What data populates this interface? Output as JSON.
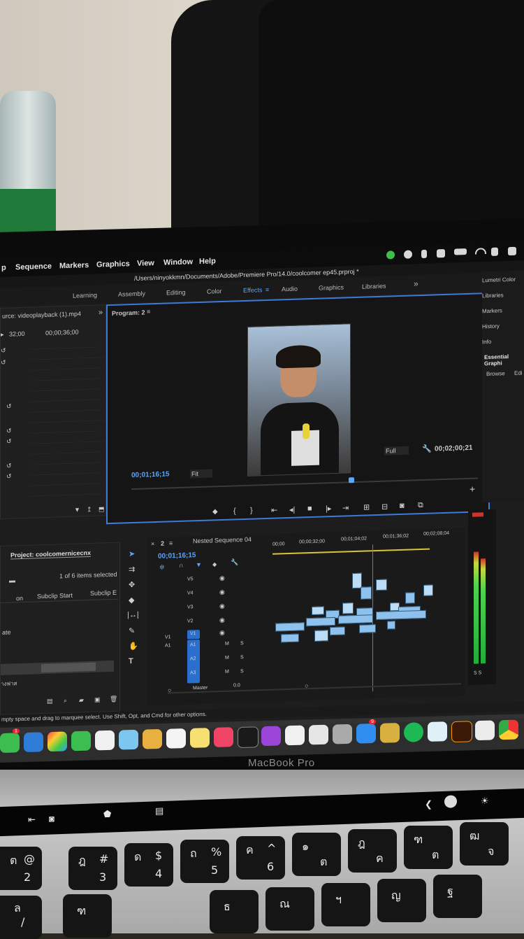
{
  "menubar": {
    "items": [
      "p",
      "Sequence",
      "Markers",
      "Graphics",
      "View",
      "Window",
      "Help"
    ]
  },
  "path": "/Users/ninyokkmn/Documents/Adobe/Premiere Pro/14.0/coolcomer ep45.prproj *",
  "workspaces": [
    "Learning",
    "Assembly",
    "Editing",
    "Color",
    "Effects",
    "Audio",
    "Graphics",
    "Libraries"
  ],
  "workspaces_overflow": "»",
  "source": {
    "title": "urce: videoplayback (1).mp4",
    "tc_left": "32;00",
    "tc_right": "00;00;36;00"
  },
  "program": {
    "title": "Program: 2",
    "current_tc": "00;01;16;15",
    "fit": "Fit",
    "quality": "Full",
    "duration_tc": "00;02;00;21"
  },
  "side_panel": [
    "Lumetri Color",
    "Libraries",
    "Markers",
    "History",
    "Info",
    "Essential Graphi",
    "Browse",
    "Edi"
  ],
  "project": {
    "title": "Project: coolcomernicecnx",
    "selection": "1 of 6 items selected",
    "col_a": "on",
    "col_b": "Subclip Start",
    "col_c": "Subclip E",
    "row_label": "ate",
    "footer_label": "างฟาส"
  },
  "timeline": {
    "tab_num": "2",
    "title": "Nested Sequence 04",
    "current_tc": "00;01;16;15",
    "ruler": [
      "00;00",
      "00;00;32;00",
      "00;01;04;02",
      "00;01;36;02",
      "00;02;08;04"
    ],
    "video_tracks": [
      "V5",
      "V4",
      "V3",
      "V2",
      "V1"
    ],
    "audio_tracks": [
      "A1",
      "A2",
      "A3"
    ],
    "src_v": "V1",
    "src_a": "A1",
    "master_label": "Master",
    "master_value": "0.0",
    "m_label": "M",
    "s_label": "S"
  },
  "meter_label": "S S",
  "status_text": "mpty space and drag to marquee select. Use Shift, Opt, and Cmd for other options.",
  "dock_badges": {
    "messages": "1",
    "appstore": "9"
  },
  "laptop_label": "MacBook Pro",
  "keyboard": {
    "row1": [
      {
        "top": "~",
        "main": "`"
      },
      {
        "top": "",
        "main": ""
      },
      {
        "top": "",
        "main": ""
      },
      {
        "top": "",
        "main": ""
      }
    ],
    "row2": [
      {
        "top": "ต",
        "mid": "@",
        "main": "2"
      },
      {
        "top": "ฎ",
        "mid": "#",
        "main": "3"
      },
      {
        "top": "ด",
        "mid": "$",
        "main": "4"
      },
      {
        "top": "ถ",
        "mid": "%",
        "main": "5"
      },
      {
        "top": "ค",
        "mid": "^",
        "main": "6"
      }
    ],
    "row3": [
      {
        "top": "ล",
        "main": "/"
      },
      {
        "top": "ต",
        "main": "2"
      },
      {
        "top": "ภ",
        "main": "3"
      },
      {
        "top": "ถ",
        "main": "4"
      },
      {
        "top": "ธ",
        "main": "5"
      },
      {
        "top": "ค",
        "main": "6"
      },
      {
        "top": "๑",
        "main": "ต"
      },
      {
        "top": "ฎ",
        "main": "ค"
      },
      {
        "top": "ฑ",
        "main": "ต"
      },
      {
        "top": "ฒ",
        "main": "จ"
      }
    ],
    "row4": [
      {
        "main": "ฑ"
      },
      {
        "main": "ธ"
      },
      {
        "main": "ณ"
      },
      {
        "main": "ฯ"
      },
      {
        "main": "ญ"
      },
      {
        "main": "ฐ"
      }
    ]
  },
  "touchbar": {
    "left": "❮",
    "right": "☀"
  }
}
